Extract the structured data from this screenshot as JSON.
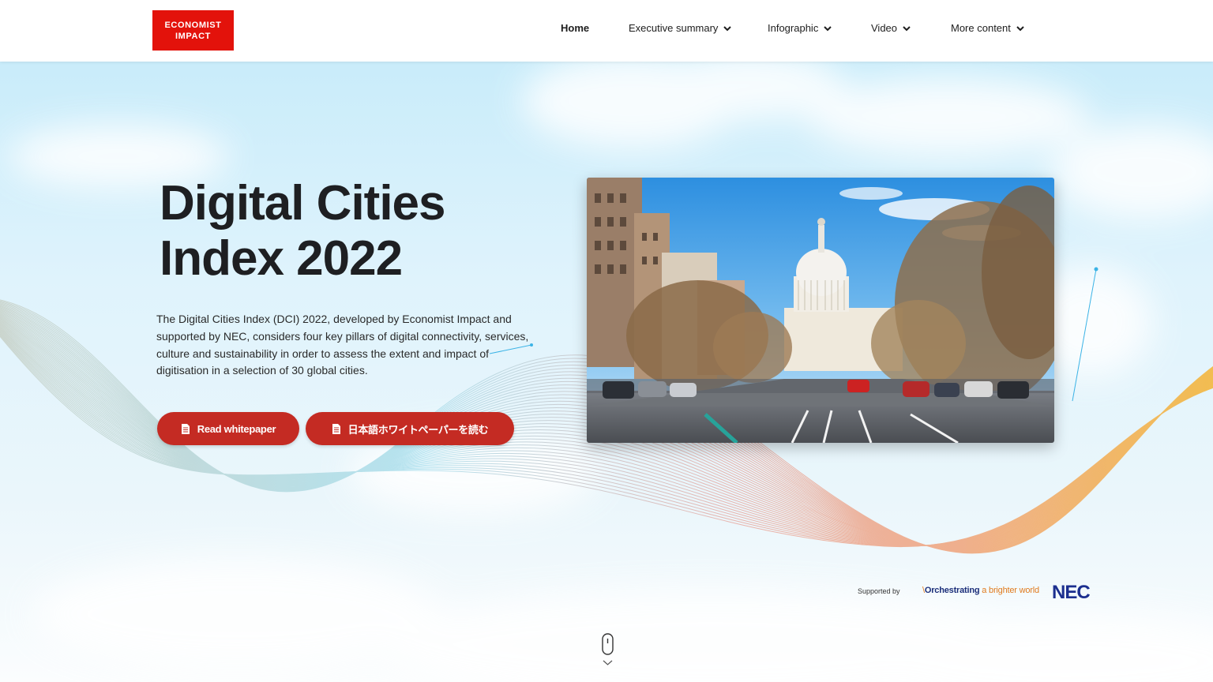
{
  "header": {
    "logo_line1": "ECONOMIST",
    "logo_line2": "IMPACT",
    "nav": [
      {
        "label": "Home",
        "active": true,
        "has_dropdown": false
      },
      {
        "label": "Executive summary",
        "active": false,
        "has_dropdown": true
      },
      {
        "label": "Infographic",
        "active": false,
        "has_dropdown": true
      },
      {
        "label": "Video",
        "active": false,
        "has_dropdown": true
      },
      {
        "label": "More content",
        "active": false,
        "has_dropdown": true
      }
    ]
  },
  "hero": {
    "title_line1": "Digital Cities",
    "title_line2": "Index 2022",
    "description": "The Digital Cities Index (DCI) 2022, developed by Economist Impact and supported by NEC, considers four key pillars of digital connectivity, services, culture and sustainability in order to assess the extent and impact of digitisation in a selection of 30 global cities.",
    "buttons": [
      {
        "label": "Read whitepaper",
        "icon": "document-icon"
      },
      {
        "label": "日本語ホワイトペーパーを読む",
        "icon": "document-icon"
      }
    ],
    "image_subject": "capitol-avenue-photo"
  },
  "sponsor": {
    "supported_by": "Supported by",
    "tagline_part1": "Orchestrating",
    "tagline_part2": "a brighter world",
    "brand": "NEC"
  },
  "colors": {
    "brand_red": "#e3120b",
    "button_red": "#c42b23",
    "nec_blue": "#1c2f8f",
    "tagline_orange": "#e07b1e"
  },
  "scroll_indicator_icon": "mouse-scroll-icon"
}
